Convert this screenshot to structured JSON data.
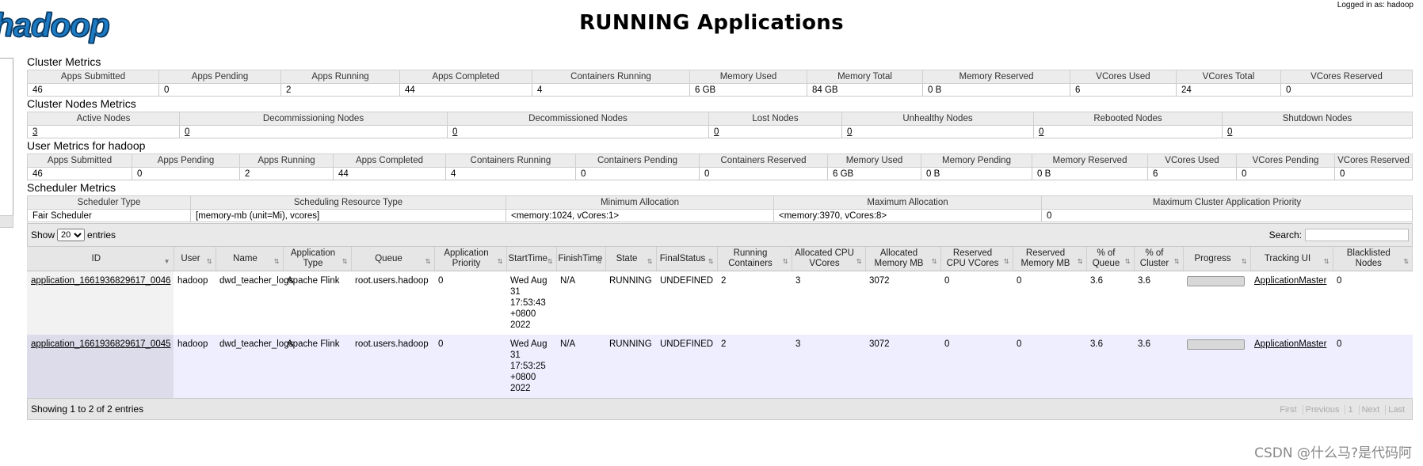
{
  "logo_text": "hadoop",
  "logged_in": "Logged in as: hadoop",
  "title": "RUNNING Applications",
  "cluster_metrics": {
    "title": "Cluster Metrics",
    "headers": [
      "Apps Submitted",
      "Apps Pending",
      "Apps Running",
      "Apps Completed",
      "Containers Running",
      "Memory Used",
      "Memory Total",
      "Memory Reserved",
      "VCores Used",
      "VCores Total",
      "VCores Reserved"
    ],
    "values": [
      "46",
      "0",
      "2",
      "44",
      "4",
      "6 GB",
      "84 GB",
      "0 B",
      "6",
      "24",
      "0"
    ]
  },
  "nodes_metrics": {
    "title": "Cluster Nodes Metrics",
    "headers": [
      "Active Nodes",
      "Decommissioning Nodes",
      "Decommissioned Nodes",
      "Lost Nodes",
      "Unhealthy Nodes",
      "Rebooted Nodes",
      "Shutdown Nodes"
    ],
    "values": [
      "3",
      "0",
      "0",
      "0",
      "0",
      "0",
      "0"
    ]
  },
  "user_metrics": {
    "title": "User Metrics for hadoop",
    "headers": [
      "Apps Submitted",
      "Apps Pending",
      "Apps Running",
      "Apps Completed",
      "Containers Running",
      "Containers Pending",
      "Containers Reserved",
      "Memory Used",
      "Memory Pending",
      "Memory Reserved",
      "VCores Used",
      "VCores Pending",
      "VCores Reserved"
    ],
    "values": [
      "46",
      "0",
      "2",
      "44",
      "4",
      "0",
      "0",
      "6 GB",
      "0 B",
      "0 B",
      "6",
      "0",
      "0"
    ]
  },
  "scheduler_metrics": {
    "title": "Scheduler Metrics",
    "headers": [
      "Scheduler Type",
      "Scheduling Resource Type",
      "Minimum Allocation",
      "Maximum Allocation",
      "Maximum Cluster Application Priority"
    ],
    "values": [
      "Fair Scheduler",
      "[memory-mb (unit=Mi), vcores]",
      "<memory:1024, vCores:1>",
      "<memory:3970, vCores:8>",
      "0"
    ]
  },
  "datatable": {
    "show_label": "Show",
    "entries_label": "entries",
    "page_size": "20",
    "search_label": "Search:",
    "info": "Showing 1 to 2 of 2 entries",
    "pager": [
      "First",
      "Previous",
      "1",
      "Next",
      "Last"
    ]
  },
  "apps": {
    "headers": [
      "ID",
      "User",
      "Name",
      "Application Type",
      "Queue",
      "Application Priority",
      "StartTime",
      "FinishTime",
      "State",
      "FinalStatus",
      "Running Containers",
      "Allocated CPU VCores",
      "Allocated Memory MB",
      "Reserved CPU VCores",
      "Reserved Memory MB",
      "% of Queue",
      "% of Cluster",
      "Progress",
      "Tracking UI",
      "Blacklisted Nodes"
    ],
    "rows": [
      {
        "id": "application_1661936829617_0046",
        "user": "hadoop",
        "name": "dwd_teacher_logs",
        "type": "Apache Flink",
        "queue": "root.users.hadoop",
        "priority": "0",
        "start": "Wed Aug 31 17:53:43 +0800 2022",
        "finish": "N/A",
        "state": "RUNNING",
        "final": "UNDEFINED",
        "containers": "2",
        "cpu": "3",
        "mem": "3072",
        "rcpu": "0",
        "rmem": "0",
        "pq": "3.6",
        "pc": "3.6",
        "progress": 0,
        "tracking": "ApplicationMaster",
        "blacklisted": "0"
      },
      {
        "id": "application_1661936829617_0045",
        "user": "hadoop",
        "name": "dwd_teacher_logs",
        "type": "Apache Flink",
        "queue": "root.users.hadoop",
        "priority": "0",
        "start": "Wed Aug 31 17:53:25 +0800 2022",
        "finish": "N/A",
        "state": "RUNNING",
        "final": "UNDEFINED",
        "containers": "2",
        "cpu": "3",
        "mem": "3072",
        "rcpu": "0",
        "rmem": "0",
        "pq": "3.6",
        "pc": "3.6",
        "progress": 0,
        "tracking": "ApplicationMaster",
        "blacklisted": "0"
      }
    ]
  },
  "watermark": "CSDN @什么马?是代码阿"
}
